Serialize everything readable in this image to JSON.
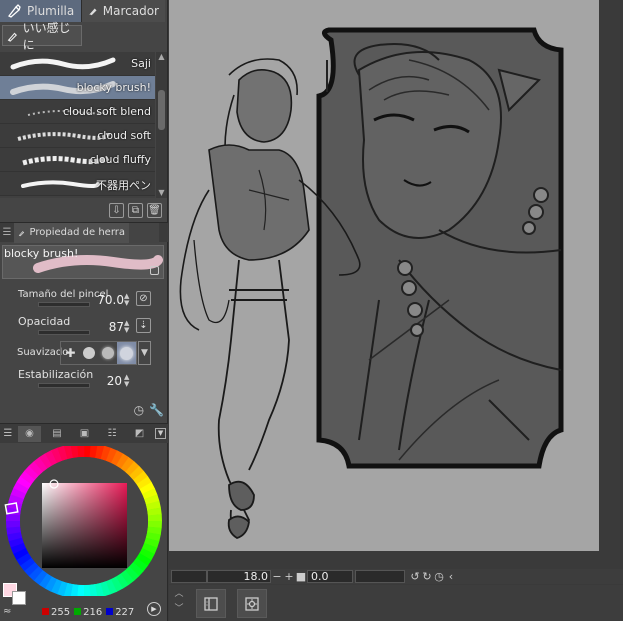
{
  "tool_tabs": [
    {
      "label": "Plumilla",
      "icon": "pen-nib-icon",
      "active": true
    },
    {
      "label": "Marcador",
      "icon": "marker-icon",
      "active": false
    }
  ],
  "sub_tool": {
    "label": "いい感じに",
    "icon": "pen-icon"
  },
  "brushes": [
    {
      "name": "Saji",
      "selected": false
    },
    {
      "name": "blocky brush!",
      "selected": true
    },
    {
      "name": "cloud soft blend",
      "selected": false
    },
    {
      "name": "cloud soft",
      "selected": false
    },
    {
      "name": "cloud fluffy",
      "selected": false
    },
    {
      "name": "不器用ペン",
      "selected": false
    }
  ],
  "tool_property": {
    "tab_label": "Propiedad de herra",
    "preview_name": "blocky brush!",
    "brush_size_label": "Tamaño del pincel",
    "brush_size_value": "70.0",
    "opacity_label": "Opacidad",
    "opacity_value": "87",
    "smoothing_label": "Suavizado",
    "stabilization_label": "Estabilización",
    "stabilization_value": "20"
  },
  "color": {
    "main_hex": "#ffd8e3",
    "r": "255",
    "g": "216",
    "b": "227"
  },
  "status": {
    "zoom": "18.0",
    "rotation": "0.0"
  },
  "accent": "#6f7f97"
}
